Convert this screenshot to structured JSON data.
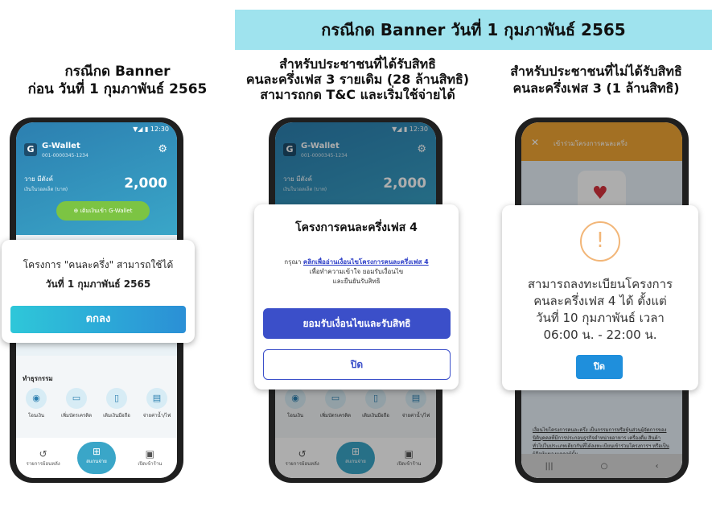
{
  "banner": {
    "title": "กรณีกด Banner วันที่ 1 กุมภาพันธ์ 2565"
  },
  "columns": {
    "left_heading": [
      "กรณีกด Banner",
      "ก่อน วันที่ 1 กุมภาพันธ์ 2565"
    ],
    "middle_heading": [
      "สำหรับประชาชนที่ได้รับสิทธิ",
      "คนละครึ่งเฟส 3 รายเดิม (28 ล้านสิทธิ)",
      "สามารถกด T&C และเริ่มใช้จ่ายได้"
    ],
    "right_heading": [
      "สำหรับประชาชนที่ไม่ได้รับสิทธิ",
      "คนละครึ่งเฟส 3 (1 ล้านสิทธิ)"
    ]
  },
  "wallet": {
    "status": "▼◢ ▮ 12:30",
    "name": "G-Wallet",
    "account": "001-0000345-1234",
    "user": "วาย มีตังค์",
    "balance_label": "เงินในวอลเล็ต (บาท)",
    "balance": "2,000",
    "topup_label": "เติมเงินเข้า G-Wallet",
    "services_title": "ทำธุรกรรม",
    "services": [
      "โอนเงิน",
      "เพิ่มบัตรเครดิต",
      "เติมเงินมือถือ",
      "จ่ายค่าน้ำ/ไฟ"
    ],
    "nav": [
      "รายการย้อนหลัง",
      "สแกนจ่าย",
      "เปิดเข้าร้าน"
    ]
  },
  "dialog1": {
    "line1": "โครงการ \"คนละครึ่ง\" สามารถใช้ได้",
    "line2": "วันที่ 1 กุมภาพันธ์ 2565",
    "button": "ตกลง"
  },
  "dialog2": {
    "title": "โครงการคนละครึ่งเฟส 4",
    "prefix": "กรุณา",
    "link": "คลิกเพื่ออ่านเงื่อนไขโครงการคนละครึ่งเฟส 4",
    "line2": "เพื่อทำความเข้าใจ ยอมรับเงื่อนไข",
    "line3": "และยืนยันรับสิทธิ",
    "accept_button": "ยอมรับเงื่อนไขและรับสิทธิ",
    "close_button": "ปิด"
  },
  "phone3": {
    "header_title": "เข้าร่วมโครงการคนละครึ่ง",
    "terms_text": "เงื่อนไขโครงการคนละครึ่ง เป็นกรรมการหรือหุ้นส่วนผู้จัดการของนิติบุคคลที่มีการประกอบธุรกิจจำหน่ายอาหาร เครื่องดื่ม สินค้าทั่วไปในประเภทเดียวกันที่ได้ลงทะเบียนเข้าร่วมโครงการฯ หรือเป็นผู้ถือหุ้นของบุคคลผู้นั้น"
  },
  "dialog3": {
    "icon": "!",
    "lines": [
      "สามารถลงทะเบียนโครงการ",
      "คนละครึ่งเฟส 4 ได้ ตั้งแต่",
      "วันที่ 10 กุมภาพันธ์ เวลา",
      "06:00 น. - 22:00 น."
    ],
    "button": "ปิด"
  }
}
